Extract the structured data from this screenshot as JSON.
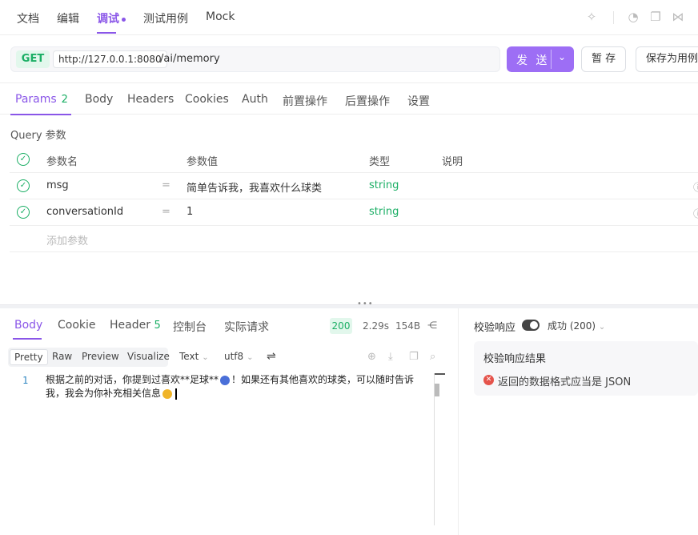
{
  "top_tabs": {
    "docs": "文档",
    "edit": "编辑",
    "debug": "调试",
    "test_cases": "测试用例",
    "mock": "Mock"
  },
  "request": {
    "method": "GET",
    "host": "http://127.0.0.1:8080",
    "path": "/ai/memory",
    "send_label": "发 送",
    "save_temp_label": "暂 存",
    "save_case_label": "保存为用例"
  },
  "req_tabs": {
    "params": "Params",
    "params_count": "2",
    "body": "Body",
    "headers": "Headers",
    "cookies": "Cookies",
    "auth": "Auth",
    "pre_ops": "前置操作",
    "post_ops": "后置操作",
    "settings": "设置"
  },
  "query_section_label": "Query 参数",
  "params_table": {
    "headers": {
      "name": "参数名",
      "value": "参数值",
      "type": "类型",
      "desc": "说明"
    },
    "rows": [
      {
        "name": "msg",
        "value": "简单告诉我，我喜欢什么球类",
        "type": "string"
      },
      {
        "name": "conversationId",
        "value": "1",
        "type": "string"
      }
    ],
    "add_placeholder": "添加参数",
    "eq": "="
  },
  "response": {
    "tabs": {
      "body": "Body",
      "cookie": "Cookie",
      "header": "Header",
      "header_count": "5",
      "console": "控制台",
      "actual_request": "实际请求"
    },
    "status_code": "200",
    "time": "2.29s",
    "size": "154B",
    "format_tabs": {
      "pretty": "Pretty",
      "raw": "Raw",
      "preview": "Preview",
      "visualize": "Visualize"
    },
    "content_type": "Text",
    "encoding": "utf8",
    "line_number": "1",
    "body_part1": "根据之前的对话，你提到过喜欢**足球**",
    "body_part2": "！如果还有其他喜欢的球类，可以随时告诉我，我会为你补充相关信息"
  },
  "validation": {
    "label": "校验响应",
    "status": "成功 (200)",
    "result_title": "校验响应结果",
    "error_text": "返回的数据格式应当是 JSON"
  },
  "colors": {
    "accent": "#8a56e8",
    "success": "#1aae64",
    "error": "#e5534b"
  }
}
